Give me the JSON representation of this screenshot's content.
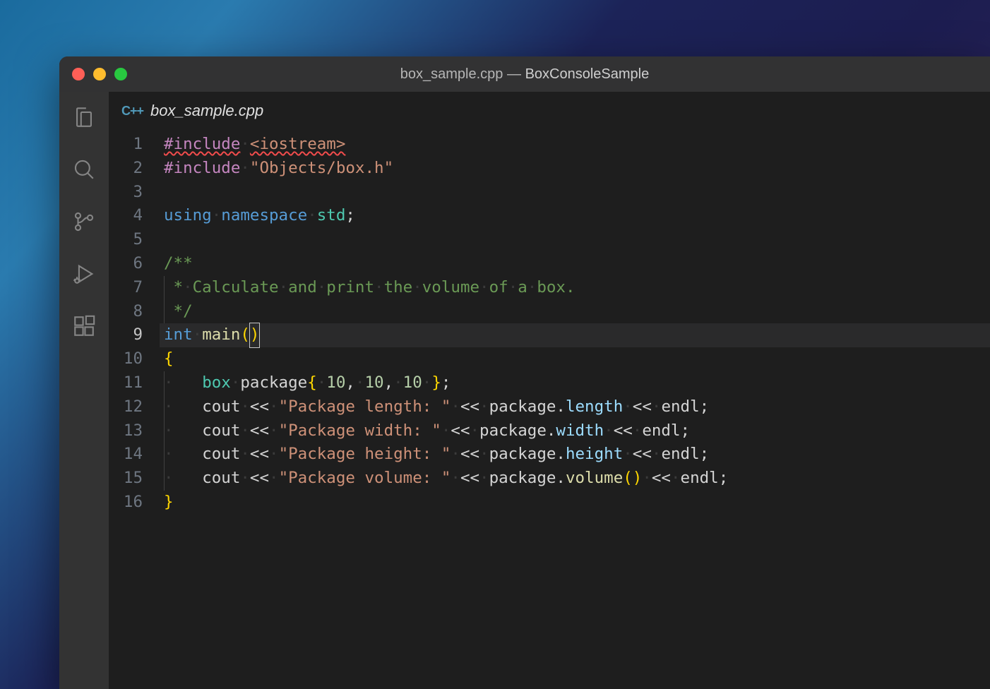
{
  "window": {
    "title_file": "box_sample.cpp",
    "title_sep": " — ",
    "title_project": "BoxConsoleSample"
  },
  "tab": {
    "icon_label": "C++",
    "filename": "box_sample.cpp"
  },
  "activitybar": {
    "items": [
      "explorer",
      "search",
      "source-control",
      "run-debug",
      "extensions"
    ]
  },
  "editor": {
    "current_line": 9,
    "lines": [
      {
        "n": 1,
        "tokens": [
          {
            "t": "#include",
            "c": "tok-include squiggle"
          },
          {
            "t": " ",
            "c": "ws"
          },
          {
            "t": "<iostream>",
            "c": "tok-string squiggle"
          }
        ]
      },
      {
        "n": 2,
        "tokens": [
          {
            "t": "#include",
            "c": "tok-include"
          },
          {
            "t": " ",
            "c": "ws"
          },
          {
            "t": "\"Objects/box.h\"",
            "c": "tok-string"
          }
        ]
      },
      {
        "n": 3,
        "tokens": []
      },
      {
        "n": 4,
        "tokens": [
          {
            "t": "using",
            "c": "tok-keyword"
          },
          {
            "t": " ",
            "c": "ws"
          },
          {
            "t": "namespace",
            "c": "tok-keyword"
          },
          {
            "t": " ",
            "c": "ws"
          },
          {
            "t": "std",
            "c": "tok-type"
          },
          {
            "t": ";",
            "c": "tok-punc"
          }
        ]
      },
      {
        "n": 5,
        "tokens": []
      },
      {
        "n": 6,
        "tokens": [
          {
            "t": "/**",
            "c": "tok-comment"
          }
        ]
      },
      {
        "n": 7,
        "indent": 1,
        "tokens": [
          {
            "t": " ",
            "c": ""
          },
          {
            "t": "*",
            "c": "tok-comment"
          },
          {
            "t": " ",
            "c": "ws"
          },
          {
            "t": "Calculate",
            "c": "tok-comment"
          },
          {
            "t": " ",
            "c": "ws"
          },
          {
            "t": "and",
            "c": "tok-comment"
          },
          {
            "t": " ",
            "c": "ws"
          },
          {
            "t": "print",
            "c": "tok-comment"
          },
          {
            "t": " ",
            "c": "ws"
          },
          {
            "t": "the",
            "c": "tok-comment"
          },
          {
            "t": " ",
            "c": "ws"
          },
          {
            "t": "volume",
            "c": "tok-comment"
          },
          {
            "t": " ",
            "c": "ws"
          },
          {
            "t": "of",
            "c": "tok-comment"
          },
          {
            "t": " ",
            "c": "ws"
          },
          {
            "t": "a",
            "c": "tok-comment"
          },
          {
            "t": " ",
            "c": "ws"
          },
          {
            "t": "box.",
            "c": "tok-comment"
          }
        ]
      },
      {
        "n": 8,
        "indent": 1,
        "tokens": [
          {
            "t": " ",
            "c": ""
          },
          {
            "t": "*/",
            "c": "tok-comment"
          }
        ]
      },
      {
        "n": 9,
        "current": true,
        "tokens": [
          {
            "t": "int",
            "c": "tok-keyword"
          },
          {
            "t": " ",
            "c": "ws"
          },
          {
            "t": "main",
            "c": "tok-func"
          },
          {
            "t": "(",
            "c": "tok-brace"
          },
          {
            "t": ")",
            "c": "tok-brace cursor-box"
          }
        ]
      },
      {
        "n": 10,
        "tokens": [
          {
            "t": "{",
            "c": "tok-brace"
          }
        ]
      },
      {
        "n": 11,
        "indent": 1,
        "tokens": [
          {
            "t": "·   ",
            "c": "ws",
            "dots": true
          },
          {
            "t": "box",
            "c": "tok-type"
          },
          {
            "t": " ",
            "c": "ws"
          },
          {
            "t": "package",
            "c": ""
          },
          {
            "t": "{",
            "c": "tok-brace"
          },
          {
            "t": " ",
            "c": "ws"
          },
          {
            "t": "10",
            "c": "tok-number"
          },
          {
            "t": ",",
            "c": "tok-punc"
          },
          {
            "t": " ",
            "c": "ws"
          },
          {
            "t": "10",
            "c": "tok-number"
          },
          {
            "t": ",",
            "c": "tok-punc"
          },
          {
            "t": " ",
            "c": "ws"
          },
          {
            "t": "10",
            "c": "tok-number"
          },
          {
            "t": " ",
            "c": "ws"
          },
          {
            "t": "}",
            "c": "tok-brace"
          },
          {
            "t": ";",
            "c": "tok-punc"
          }
        ]
      },
      {
        "n": 12,
        "indent": 1,
        "tokens": [
          {
            "t": "·   ",
            "c": "ws",
            "dots": true
          },
          {
            "t": "cout",
            "c": ""
          },
          {
            "t": " ",
            "c": "ws"
          },
          {
            "t": "<<",
            "c": "tok-punc"
          },
          {
            "t": " ",
            "c": "ws"
          },
          {
            "t": "\"Package length: \"",
            "c": "tok-string"
          },
          {
            "t": " ",
            "c": "ws"
          },
          {
            "t": "<<",
            "c": "tok-punc"
          },
          {
            "t": " ",
            "c": "ws"
          },
          {
            "t": "package",
            "c": ""
          },
          {
            "t": ".",
            "c": "tok-punc"
          },
          {
            "t": "length",
            "c": "tok-member"
          },
          {
            "t": " ",
            "c": "ws"
          },
          {
            "t": "<<",
            "c": "tok-punc"
          },
          {
            "t": " ",
            "c": "ws"
          },
          {
            "t": "endl",
            "c": ""
          },
          {
            "t": ";",
            "c": "tok-punc"
          }
        ]
      },
      {
        "n": 13,
        "indent": 1,
        "tokens": [
          {
            "t": "·   ",
            "c": "ws",
            "dots": true
          },
          {
            "t": "cout",
            "c": ""
          },
          {
            "t": " ",
            "c": "ws"
          },
          {
            "t": "<<",
            "c": "tok-punc"
          },
          {
            "t": " ",
            "c": "ws"
          },
          {
            "t": "\"Package width: \"",
            "c": "tok-string"
          },
          {
            "t": " ",
            "c": "ws"
          },
          {
            "t": "<<",
            "c": "tok-punc"
          },
          {
            "t": " ",
            "c": "ws"
          },
          {
            "t": "package",
            "c": ""
          },
          {
            "t": ".",
            "c": "tok-punc"
          },
          {
            "t": "width",
            "c": "tok-member"
          },
          {
            "t": " ",
            "c": "ws"
          },
          {
            "t": "<<",
            "c": "tok-punc"
          },
          {
            "t": " ",
            "c": "ws"
          },
          {
            "t": "endl",
            "c": ""
          },
          {
            "t": ";",
            "c": "tok-punc"
          }
        ]
      },
      {
        "n": 14,
        "indent": 1,
        "tokens": [
          {
            "t": "·   ",
            "c": "ws",
            "dots": true
          },
          {
            "t": "cout",
            "c": ""
          },
          {
            "t": " ",
            "c": "ws"
          },
          {
            "t": "<<",
            "c": "tok-punc"
          },
          {
            "t": " ",
            "c": "ws"
          },
          {
            "t": "\"Package height: \"",
            "c": "tok-string"
          },
          {
            "t": " ",
            "c": "ws"
          },
          {
            "t": "<<",
            "c": "tok-punc"
          },
          {
            "t": " ",
            "c": "ws"
          },
          {
            "t": "package",
            "c": ""
          },
          {
            "t": ".",
            "c": "tok-punc"
          },
          {
            "t": "height",
            "c": "tok-member"
          },
          {
            "t": " ",
            "c": "ws"
          },
          {
            "t": "<<",
            "c": "tok-punc"
          },
          {
            "t": " ",
            "c": "ws"
          },
          {
            "t": "endl",
            "c": ""
          },
          {
            "t": ";",
            "c": "tok-punc"
          }
        ]
      },
      {
        "n": 15,
        "indent": 1,
        "tokens": [
          {
            "t": "·   ",
            "c": "ws",
            "dots": true
          },
          {
            "t": "cout",
            "c": ""
          },
          {
            "t": " ",
            "c": "ws"
          },
          {
            "t": "<<",
            "c": "tok-punc"
          },
          {
            "t": " ",
            "c": "ws"
          },
          {
            "t": "\"Package volume: \"",
            "c": "tok-string"
          },
          {
            "t": " ",
            "c": "ws"
          },
          {
            "t": "<<",
            "c": "tok-punc"
          },
          {
            "t": " ",
            "c": "ws"
          },
          {
            "t": "package",
            "c": ""
          },
          {
            "t": ".",
            "c": "tok-punc"
          },
          {
            "t": "volume",
            "c": "tok-func"
          },
          {
            "t": "(",
            "c": "tok-brace"
          },
          {
            "t": ")",
            "c": "tok-brace"
          },
          {
            "t": " ",
            "c": "ws"
          },
          {
            "t": "<<",
            "c": "tok-punc"
          },
          {
            "t": " ",
            "c": "ws"
          },
          {
            "t": "endl",
            "c": ""
          },
          {
            "t": ";",
            "c": "tok-punc"
          }
        ]
      },
      {
        "n": 16,
        "tokens": [
          {
            "t": "}",
            "c": "tok-brace"
          }
        ]
      }
    ]
  }
}
